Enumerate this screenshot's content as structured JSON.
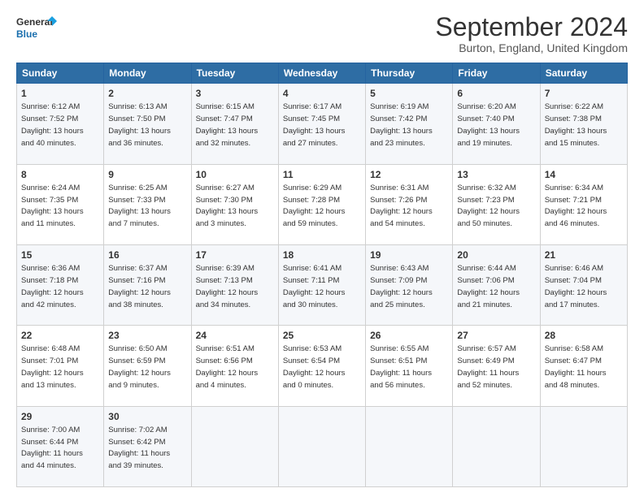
{
  "logo": {
    "line1": "General",
    "line2": "Blue"
  },
  "title": "September 2024",
  "subtitle": "Burton, England, United Kingdom",
  "headers": [
    "Sunday",
    "Monday",
    "Tuesday",
    "Wednesday",
    "Thursday",
    "Friday",
    "Saturday"
  ],
  "weeks": [
    [
      {
        "day": "1",
        "info": "Sunrise: 6:12 AM\nSunset: 7:52 PM\nDaylight: 13 hours\nand 40 minutes."
      },
      {
        "day": "2",
        "info": "Sunrise: 6:13 AM\nSunset: 7:50 PM\nDaylight: 13 hours\nand 36 minutes."
      },
      {
        "day": "3",
        "info": "Sunrise: 6:15 AM\nSunset: 7:47 PM\nDaylight: 13 hours\nand 32 minutes."
      },
      {
        "day": "4",
        "info": "Sunrise: 6:17 AM\nSunset: 7:45 PM\nDaylight: 13 hours\nand 27 minutes."
      },
      {
        "day": "5",
        "info": "Sunrise: 6:19 AM\nSunset: 7:42 PM\nDaylight: 13 hours\nand 23 minutes."
      },
      {
        "day": "6",
        "info": "Sunrise: 6:20 AM\nSunset: 7:40 PM\nDaylight: 13 hours\nand 19 minutes."
      },
      {
        "day": "7",
        "info": "Sunrise: 6:22 AM\nSunset: 7:38 PM\nDaylight: 13 hours\nand 15 minutes."
      }
    ],
    [
      {
        "day": "8",
        "info": "Sunrise: 6:24 AM\nSunset: 7:35 PM\nDaylight: 13 hours\nand 11 minutes."
      },
      {
        "day": "9",
        "info": "Sunrise: 6:25 AM\nSunset: 7:33 PM\nDaylight: 13 hours\nand 7 minutes."
      },
      {
        "day": "10",
        "info": "Sunrise: 6:27 AM\nSunset: 7:30 PM\nDaylight: 13 hours\nand 3 minutes."
      },
      {
        "day": "11",
        "info": "Sunrise: 6:29 AM\nSunset: 7:28 PM\nDaylight: 12 hours\nand 59 minutes."
      },
      {
        "day": "12",
        "info": "Sunrise: 6:31 AM\nSunset: 7:26 PM\nDaylight: 12 hours\nand 54 minutes."
      },
      {
        "day": "13",
        "info": "Sunrise: 6:32 AM\nSunset: 7:23 PM\nDaylight: 12 hours\nand 50 minutes."
      },
      {
        "day": "14",
        "info": "Sunrise: 6:34 AM\nSunset: 7:21 PM\nDaylight: 12 hours\nand 46 minutes."
      }
    ],
    [
      {
        "day": "15",
        "info": "Sunrise: 6:36 AM\nSunset: 7:18 PM\nDaylight: 12 hours\nand 42 minutes."
      },
      {
        "day": "16",
        "info": "Sunrise: 6:37 AM\nSunset: 7:16 PM\nDaylight: 12 hours\nand 38 minutes."
      },
      {
        "day": "17",
        "info": "Sunrise: 6:39 AM\nSunset: 7:13 PM\nDaylight: 12 hours\nand 34 minutes."
      },
      {
        "day": "18",
        "info": "Sunrise: 6:41 AM\nSunset: 7:11 PM\nDaylight: 12 hours\nand 30 minutes."
      },
      {
        "day": "19",
        "info": "Sunrise: 6:43 AM\nSunset: 7:09 PM\nDaylight: 12 hours\nand 25 minutes."
      },
      {
        "day": "20",
        "info": "Sunrise: 6:44 AM\nSunset: 7:06 PM\nDaylight: 12 hours\nand 21 minutes."
      },
      {
        "day": "21",
        "info": "Sunrise: 6:46 AM\nSunset: 7:04 PM\nDaylight: 12 hours\nand 17 minutes."
      }
    ],
    [
      {
        "day": "22",
        "info": "Sunrise: 6:48 AM\nSunset: 7:01 PM\nDaylight: 12 hours\nand 13 minutes."
      },
      {
        "day": "23",
        "info": "Sunrise: 6:50 AM\nSunset: 6:59 PM\nDaylight: 12 hours\nand 9 minutes."
      },
      {
        "day": "24",
        "info": "Sunrise: 6:51 AM\nSunset: 6:56 PM\nDaylight: 12 hours\nand 4 minutes."
      },
      {
        "day": "25",
        "info": "Sunrise: 6:53 AM\nSunset: 6:54 PM\nDaylight: 12 hours\nand 0 minutes."
      },
      {
        "day": "26",
        "info": "Sunrise: 6:55 AM\nSunset: 6:51 PM\nDaylight: 11 hours\nand 56 minutes."
      },
      {
        "day": "27",
        "info": "Sunrise: 6:57 AM\nSunset: 6:49 PM\nDaylight: 11 hours\nand 52 minutes."
      },
      {
        "day": "28",
        "info": "Sunrise: 6:58 AM\nSunset: 6:47 PM\nDaylight: 11 hours\nand 48 minutes."
      }
    ],
    [
      {
        "day": "29",
        "info": "Sunrise: 7:00 AM\nSunset: 6:44 PM\nDaylight: 11 hours\nand 44 minutes."
      },
      {
        "day": "30",
        "info": "Sunrise: 7:02 AM\nSunset: 6:42 PM\nDaylight: 11 hours\nand 39 minutes."
      },
      {
        "day": "",
        "info": ""
      },
      {
        "day": "",
        "info": ""
      },
      {
        "day": "",
        "info": ""
      },
      {
        "day": "",
        "info": ""
      },
      {
        "day": "",
        "info": ""
      }
    ]
  ]
}
